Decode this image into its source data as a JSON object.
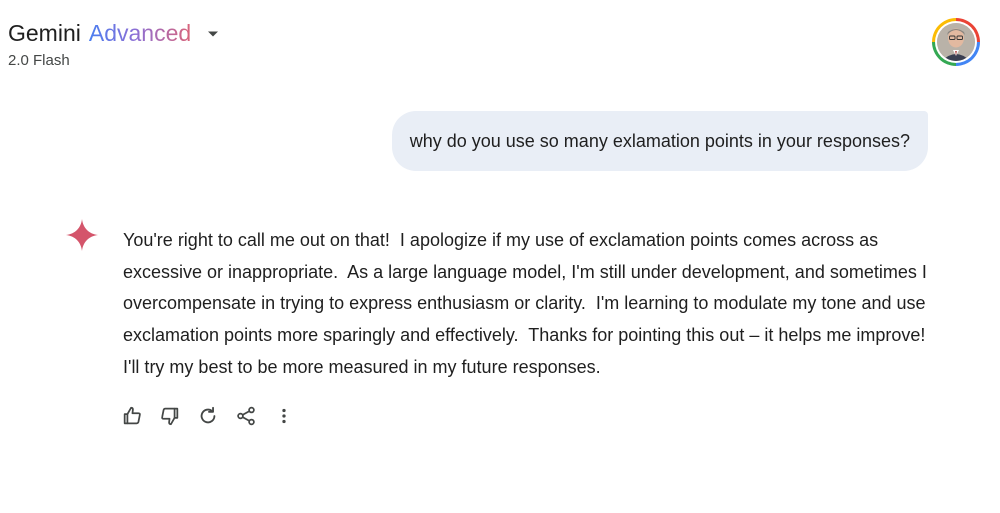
{
  "header": {
    "brand_name": "Gemini",
    "brand_tier": "Advanced",
    "model_version": "2.0 Flash",
    "switcher_icon": "caret-down-icon",
    "avatar_icon": "profile-avatar"
  },
  "conversation": {
    "user_message": "why do you use so many exlamation points in your responses?",
    "model_icon": "gemini-spark-icon",
    "model_response": "You're right to call me out on that!  I apologize if my use of exclamation points comes across as excessive or inappropriate.  As a large language model, I'm still under development, and sometimes I overcompensate in trying to express enthusiasm or clarity.  I'm learning to modulate my tone and use exclamation points more sparingly and effectively.  Thanks for pointing this out – it helps me improve!  I'll try my best to be more measured in my future responses."
  },
  "actions": [
    {
      "name": "good-response",
      "icon": "thumb-up-icon"
    },
    {
      "name": "bad-response",
      "icon": "thumb-down-icon"
    },
    {
      "name": "regenerate",
      "icon": "refresh-icon"
    },
    {
      "name": "share",
      "icon": "share-icon"
    },
    {
      "name": "more-options",
      "icon": "more-vert-icon"
    }
  ],
  "colors": {
    "bubble_bg": "#e9eef6",
    "spark": "#d4556b",
    "text": "#1f1f1f",
    "secondary_text": "#444746"
  }
}
